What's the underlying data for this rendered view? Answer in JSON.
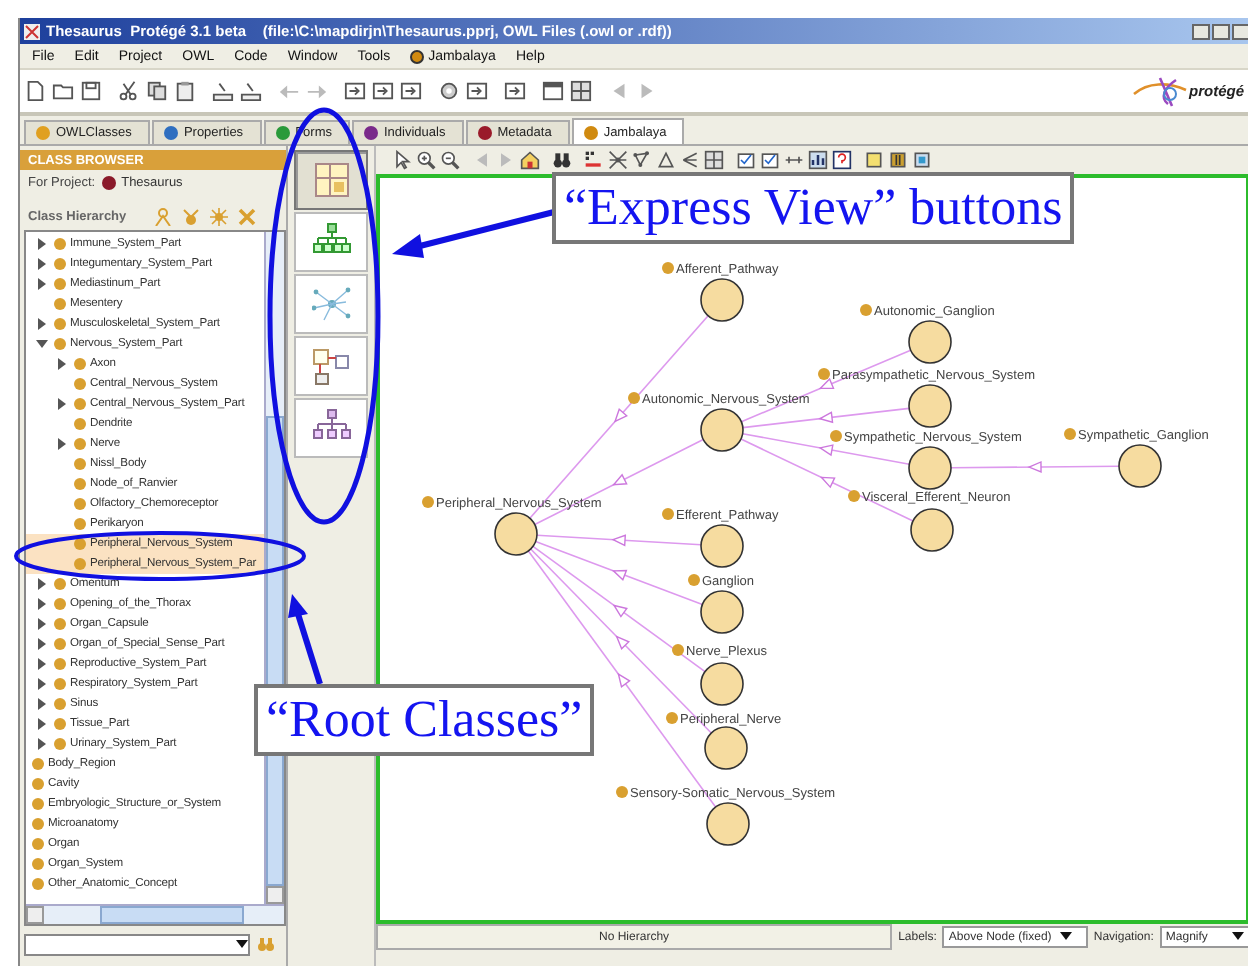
{
  "window": {
    "title": "Thesaurus  Protégé 3.1 beta    (file:\\C:\\mapdirjn\\Thesaurus.pprj, OWL Files (.owl or .rdf))"
  },
  "menu": [
    "File",
    "Edit",
    "Project",
    "OWL",
    "Code",
    "Window",
    "Tools",
    "Jambalaya",
    "Help"
  ],
  "logo": {
    "text": "protégé"
  },
  "tabs": [
    {
      "label": "OWLClasses",
      "selected": false,
      "color": "#e0a020"
    },
    {
      "label": "Properties",
      "selected": false,
      "color": "#2f6fc0"
    },
    {
      "label": "Forms",
      "selected": false,
      "color": "#2a9a3a"
    },
    {
      "label": "Individuals",
      "selected": false,
      "color": "#7a2a8a"
    },
    {
      "label": "Metadata",
      "selected": false,
      "color": "#9a1a2a"
    },
    {
      "label": "Jambalaya",
      "selected": true,
      "color": "#d08a10"
    }
  ],
  "class_browser": {
    "title": "CLASS BROWSER",
    "project_label": "For Project:",
    "project": "Thesaurus",
    "hierarchy_label": "Class Hierarchy",
    "tree": [
      {
        "kind": "offscreen",
        "children": [
          {
            "kind": "branch",
            "label": "Immune_System_Part",
            "expanded": false,
            "selected": false
          },
          {
            "kind": "branch",
            "label": "Integumentary_System_Part",
            "expanded": false,
            "selected": false
          },
          {
            "kind": "branch",
            "label": "Mediastinum_Part",
            "expanded": false,
            "selected": false
          },
          {
            "kind": "leaf",
            "label": "Mesentery",
            "selected": false
          },
          {
            "kind": "branch",
            "label": "Musculoskeletal_System_Part",
            "expanded": false,
            "selected": false
          },
          {
            "kind": "branch",
            "label": "Nervous_System_Part",
            "expanded": true,
            "selected": false,
            "children": [
              {
                "kind": "branch",
                "label": "Axon",
                "expanded": false,
                "selected": false
              },
              {
                "kind": "leaf",
                "label": "Central_Nervous_System",
                "selected": false
              },
              {
                "kind": "branch",
                "label": "Central_Nervous_System_Part",
                "expanded": false,
                "selected": false
              },
              {
                "kind": "leaf",
                "label": "Dendrite",
                "selected": false
              },
              {
                "kind": "branch",
                "label": "Nerve",
                "expanded": false,
                "selected": false
              },
              {
                "kind": "leaf",
                "label": "Nissl_Body",
                "selected": false
              },
              {
                "kind": "leaf",
                "label": "Node_of_Ranvier",
                "selected": false
              },
              {
                "kind": "leaf",
                "label": "Olfactory_Chemoreceptor",
                "selected": false
              },
              {
                "kind": "leaf",
                "label": "Perikaryon",
                "selected": false
              },
              {
                "kind": "leaf",
                "label": "Peripheral_Nervous_System",
                "selected": true
              },
              {
                "kind": "leaf",
                "label": "Peripheral_Nervous_System_Par",
                "selected": true
              }
            ]
          },
          {
            "kind": "branch",
            "label": "Omentum",
            "expanded": false,
            "selected": false
          },
          {
            "kind": "branch",
            "label": "Opening_of_the_Thorax",
            "expanded": false,
            "selected": false
          },
          {
            "kind": "branch",
            "label": "Organ_Capsule",
            "expanded": false,
            "selected": false
          },
          {
            "kind": "branch",
            "label": "Organ_of_Special_Sense_Part",
            "expanded": false,
            "selected": false
          },
          {
            "kind": "branch",
            "label": "Reproductive_System_Part",
            "expanded": false,
            "selected": false
          },
          {
            "kind": "branch",
            "label": "Respiratory_System_Part",
            "expanded": false,
            "selected": false
          },
          {
            "kind": "branch",
            "label": "Sinus",
            "expanded": false,
            "selected": false
          },
          {
            "kind": "branch",
            "label": "Tissue_Part",
            "expanded": false,
            "selected": false
          },
          {
            "kind": "branch",
            "label": "Urinary_System_Part",
            "expanded": false,
            "selected": false
          }
        ]
      },
      {
        "kind": "leaf",
        "label": "Body_Region",
        "selected": false
      },
      {
        "kind": "leaf",
        "label": "Cavity",
        "selected": false
      },
      {
        "kind": "leaf",
        "label": "Embryologic_Structure_or_System",
        "selected": false
      },
      {
        "kind": "leaf",
        "label": "Microanatomy",
        "selected": false
      },
      {
        "kind": "leaf",
        "label": "Organ",
        "selected": false
      },
      {
        "kind": "leaf",
        "label": "Organ_System",
        "selected": false
      },
      {
        "kind": "leaf",
        "label": "Other_Anatomic_Concept",
        "selected": false
      }
    ]
  },
  "express_views": [
    {
      "selected": true
    },
    {
      "selected": false
    },
    {
      "selected": false
    },
    {
      "selected": false
    },
    {
      "selected": false
    }
  ],
  "graph": {
    "root": {
      "label": "Peripheral_Nervous_System",
      "children": [
        {
          "label": "Afferent_Pathway"
        },
        {
          "label": "Autonomic_Nervous_System",
          "children": [
            {
              "label": "Autonomic_Ganglion"
            },
            {
              "label": "Parasympathetic_Nervous_System"
            },
            {
              "label": "Sympathetic_Nervous_System",
              "children": [
                {
                  "label": "Sympathetic_Ganglion"
                }
              ]
            },
            {
              "label": "Visceral_Efferent_Neuron"
            }
          ]
        },
        {
          "label": "Efferent_Pathway"
        },
        {
          "label": "Ganglion"
        },
        {
          "label": "Nerve_Plexus"
        },
        {
          "label": "Peripheral_Nerve"
        },
        {
          "label": "Sensory-Somatic_Nervous_System"
        }
      ]
    }
  },
  "status_bar": {
    "hierarchy": "No Hierarchy",
    "labels_label": "Labels:",
    "labels_value": "Above Node (fixed)",
    "navigation_label": "Navigation:",
    "navigation_value": "Magnify"
  },
  "annotations": [
    {
      "kind": "callout",
      "text": "“Express View” buttons"
    },
    {
      "kind": "callout",
      "text": "“Root Classes”"
    }
  ]
}
